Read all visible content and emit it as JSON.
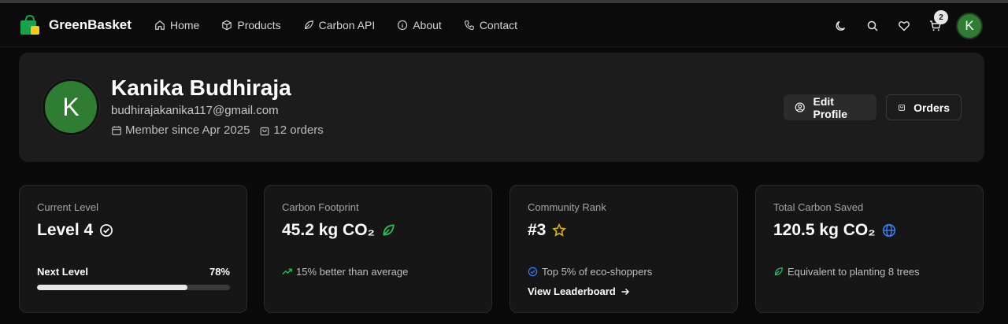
{
  "brand": {
    "name": "GreenBasket"
  },
  "nav": {
    "links": [
      {
        "label": "Home",
        "icon": "home-icon"
      },
      {
        "label": "Products",
        "icon": "box-icon"
      },
      {
        "label": "Carbon API",
        "icon": "leaf-icon"
      },
      {
        "label": "About",
        "icon": "info-icon"
      },
      {
        "label": "Contact",
        "icon": "phone-icon"
      }
    ],
    "cart_count": "2",
    "avatar_initial": "K"
  },
  "profile": {
    "initial": "K",
    "name": "Kanika Budhiraja",
    "email": "budhirajakanika117@gmail.com",
    "member_since": "Member since Apr 2025",
    "orders_count": "12 orders",
    "edit_label": "Edit Profile",
    "orders_label": "Orders"
  },
  "stats": {
    "level": {
      "label": "Current Level",
      "value": "Level 4",
      "progress_label": "Next Level",
      "progress_text": "78%",
      "progress": 0.78
    },
    "footprint": {
      "label": "Carbon Footprint",
      "value": "45.2 kg CO₂",
      "sub": "15% better than average"
    },
    "rank": {
      "label": "Community Rank",
      "value": "#3",
      "sub": "Top 5% of eco-shoppers",
      "link": "View Leaderboard"
    },
    "saved": {
      "label": "Total Carbon Saved",
      "value": "120.5 kg CO₂",
      "sub": "Equivalent to planting 8 trees"
    }
  },
  "colors": {
    "accent_green": "#22c55e",
    "avatar_green": "#2e7d32",
    "star": "#eab308",
    "globe": "#3b82f6"
  }
}
